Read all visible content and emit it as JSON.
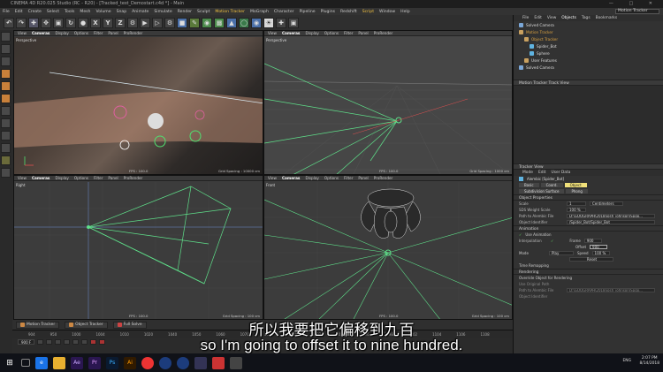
{
  "window": {
    "title": "CINEMA 4D R20.025 Studio (RC - R20) - [Tracked_test_Demostart.c4d *] - Main"
  },
  "menu": [
    "File",
    "Edit",
    "Create",
    "Select",
    "Tools",
    "Mesh",
    "Volume",
    "Snap",
    "Animate",
    "Simulate",
    "Render",
    "Sculpt",
    "Motion Tracker",
    "MoGraph",
    "Character",
    "Pipeline",
    "Plugins",
    "Redshift",
    "Script",
    "Window",
    "Help"
  ],
  "layout": {
    "label": "Layout:",
    "value": "Motion Tracker"
  },
  "toolbar": {
    "x": "X",
    "y": "Y",
    "z": "Z"
  },
  "viewport_menu": [
    "View",
    "Cameras",
    "Display",
    "Options",
    "Filter",
    "Panel",
    "ProRender"
  ],
  "viewports": {
    "tl": {
      "label": "Perspective",
      "fps": "FPS : 100.0",
      "grid": "Grid Spacing : 10000 cm"
    },
    "tr": {
      "label": "Perspective",
      "fps": "FPS : 100.0",
      "grid": "Grid Spacing : 1000 cm"
    },
    "bl": {
      "label": "Right",
      "fps": "FPS : 100.0",
      "grid": "Grid Spacing : 100 cm"
    },
    "br": {
      "label": "Front",
      "fps": "FPS : 100.0",
      "grid": "Grid Spacing : 100 cm"
    }
  },
  "objects_panel": {
    "tabs": [
      "File",
      "Edit",
      "View",
      "Objects",
      "Tags",
      "Bookmarks"
    ],
    "items": [
      "Solved Camera",
      "Motion Tracker",
      "Object Tracker",
      "Spider_Bot",
      "Sphere",
      "User Features",
      "Solved Camera"
    ]
  },
  "track_view": {
    "title": "Motion Tracker Track View"
  },
  "attributes": {
    "header": "Tracker View",
    "tabs_top": [
      "Mode",
      "Edit",
      "User Data"
    ],
    "object_name": "Alembic [Spider_Bot]",
    "tabs": [
      "Basic",
      "Coord.",
      "Object"
    ],
    "tabs2": [
      "Subdivision Surface",
      "Phong"
    ],
    "properties_title": "Object Properties",
    "scale_label": "Scale",
    "scale_value": "1",
    "scale_unit": "Centimeters",
    "pos_label": "SDS Weight Scale",
    "pos_value": "100 %",
    "path_label": "Path to Alembic File",
    "path_value": "D:\\GOOGRAPH\\2018\\josh_johnson\\Spgo...",
    "identifier_label": "Object Identifier",
    "identifier_value": "/Spider_Bot/Spider_Bot",
    "animation_title": "Animation",
    "use_animation": "Use Animation",
    "interpolation": "Interpolation",
    "frame_label": "Frame",
    "frame_value": "900",
    "offset_label": "Offset",
    "offset_value": "900",
    "mode_label": "Mode",
    "mode_value": "Play",
    "speed_label": "Speed",
    "speed_value": "100 %",
    "reset_label": "Reset",
    "time_remap": "Time Remapping",
    "rendering_title": "Rendering",
    "override_label": "Override Object for Rendering",
    "use_orig": "Use Original Path",
    "path_render_label": "Path to Alembic File",
    "path_render_value": "D:\\GOOGRAPH\\2018\\josh_johnson\\Spgo...",
    "obj_ident2": "Object Identifier"
  },
  "playback": {
    "buttons": [
      "Motion Tracker",
      "Object Tracker",
      "Full Solve"
    ]
  },
  "timeline_ticks": [
    "904",
    "950",
    "1000",
    "1004",
    "1010",
    "1020",
    "1040",
    "1050",
    "1060",
    "1070",
    "1080",
    "1090",
    "1092",
    "1094",
    "1096",
    "1098",
    "1102",
    "1104",
    "1106",
    "1108"
  ],
  "frame_field": "900 F",
  "taskbar": {
    "lang": "ENG",
    "time": "2:07 PM",
    "date": "8/14/2018"
  },
  "subtitles": {
    "zh": "所以我要把它偏移到九百",
    "en": "so I'm going to offset it to nine hundred."
  }
}
